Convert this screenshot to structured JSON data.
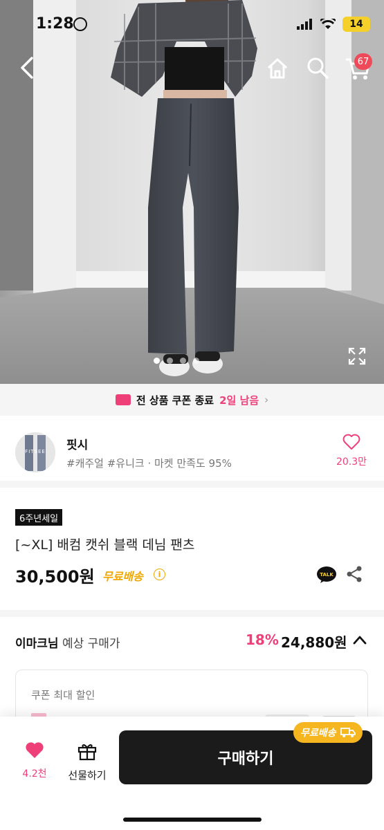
{
  "status_bar": {
    "time": "1:28",
    "battery": "14"
  },
  "header": {
    "cart_count": "67"
  },
  "carousel": {
    "total": 4,
    "active_index": 0
  },
  "coupon_banner": {
    "title": "전 상품 쿠폰 종료",
    "remaining": "2일 남음"
  },
  "shop": {
    "name": "핏시",
    "avatar_text": "FITSEE",
    "meta": "#캐주얼 #유니크 · 마켓 만족도 95%",
    "likes": "20.3만"
  },
  "product": {
    "tag": "6주년세일",
    "title": "[~XL] 배컴 캣쉬 블랙 데님 팬츠",
    "price": "30,500원",
    "shipping": "무료배송"
  },
  "expected": {
    "user": "이마크님",
    "label": "예상 구매가",
    "discount": "18%",
    "price": "24,880원"
  },
  "coupon_box": {
    "title": "쿠폰 최대 할인"
  },
  "bottom_bar": {
    "like_count": "4.2천",
    "gift_label": "선물하기",
    "buy_label": "구매하기",
    "ship_badge": "무료배송"
  },
  "colors": {
    "accent": "#ef3f79",
    "ship": "#f0a800",
    "buy_button": "#1b1b1b"
  }
}
